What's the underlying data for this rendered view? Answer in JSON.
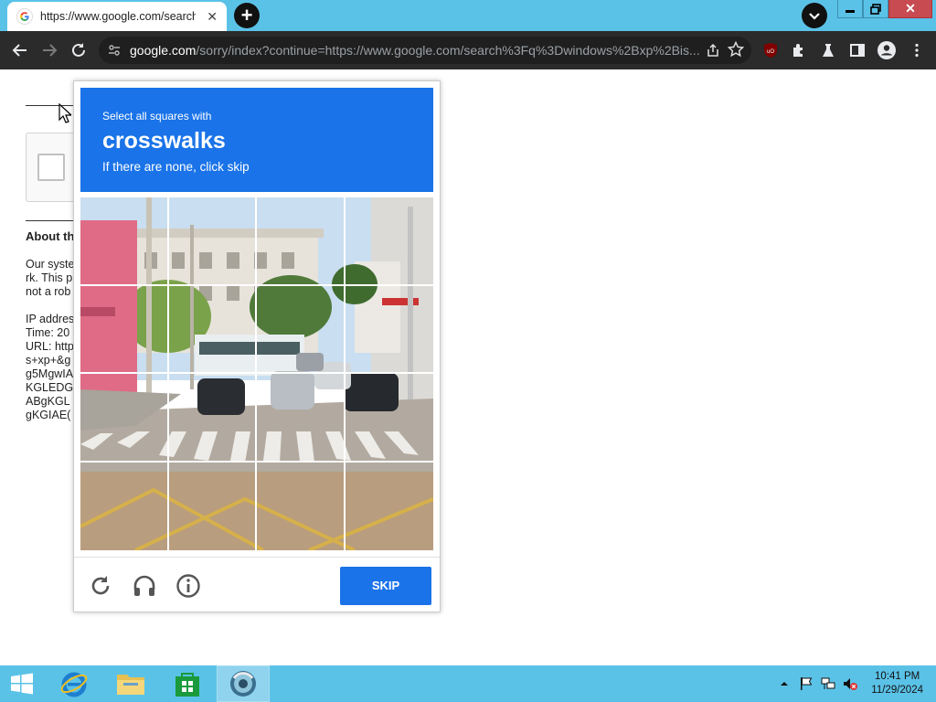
{
  "browser": {
    "tab_title": "https://www.google.com/search",
    "url_host": "google.com",
    "url_rest": "/sorry/index?continue=https://www.google.com/search%3Fq%3Dwindows%2Bxp%2Bis..."
  },
  "page": {
    "about_title": "About th",
    "body_lines": [
      "Our syste",
      "rk. This p",
      "not a rob",
      "",
      "IP addres",
      "Time: 20",
      "URL: http",
      "s+xp+&g",
      "g5MgwIA",
      "KGLEDG",
      "ABgKGL",
      "gKGIAE("
    ]
  },
  "captcha": {
    "instruction": "Select all squares with",
    "target": "crosswalks",
    "hint": "If there are none, click skip",
    "skip_label": "SKIP",
    "colors": {
      "header": "#1a73e8",
      "button": "#1a73e8"
    }
  },
  "taskbar": {
    "time": "10:41 PM",
    "date": "11/29/2024"
  }
}
